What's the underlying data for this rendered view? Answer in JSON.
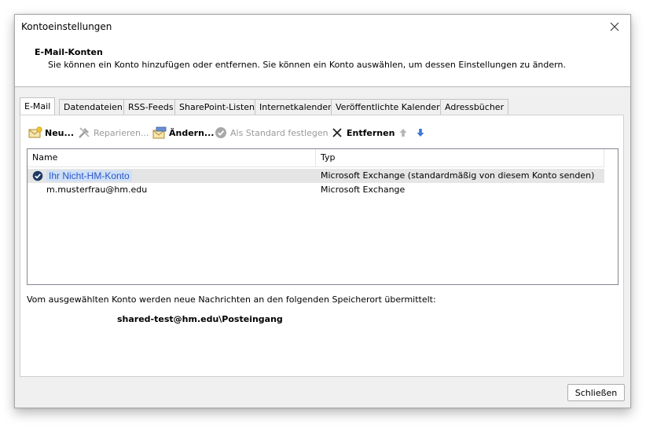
{
  "window": {
    "title": "Kontoeinstellungen"
  },
  "header": {
    "title": "E-Mail-Konten",
    "description": "Sie können ein Konto hinzufügen oder entfernen. Sie können ein Konto auswählen, um dessen Einstellungen zu ändern."
  },
  "tabs": [
    {
      "label": "E-Mail",
      "active": true
    },
    {
      "label": "Datendateien"
    },
    {
      "label": "RSS-Feeds"
    },
    {
      "label": "SharePoint-Listen"
    },
    {
      "label": "Internetkalender"
    },
    {
      "label": "Veröffentlichte Kalender"
    },
    {
      "label": "Adressbücher"
    }
  ],
  "toolbar": {
    "new_label": "Neu...",
    "repair_label": "Reparieren...",
    "change_label": "Ändern...",
    "default_label": "Als Standard festlegen",
    "remove_label": "Entfernen",
    "up_icon": "arrow-up-icon",
    "down_icon": "arrow-down-icon"
  },
  "accounts": {
    "columns": [
      "Name",
      "Typ"
    ],
    "rows": [
      {
        "name": "Ihr Nicht-HM-Konto",
        "type": "Microsoft Exchange (standardmäßig von diesem Konto senden)",
        "default": true
      },
      {
        "name": "m.musterfrau@hm.edu",
        "type": "Microsoft Exchange",
        "default": false
      }
    ]
  },
  "delivery": {
    "info": "Vom ausgewählten Konto werden neue Nachrichten an den folgenden Speicherort übermittelt:",
    "location": "shared-test@hm.edu\\Posteingang"
  },
  "footer": {
    "close_label": "Schließen"
  },
  "colors": {
    "accent": "#2a55c8",
    "selection": "#e5e5e5",
    "arrow": "#3c78d8"
  }
}
